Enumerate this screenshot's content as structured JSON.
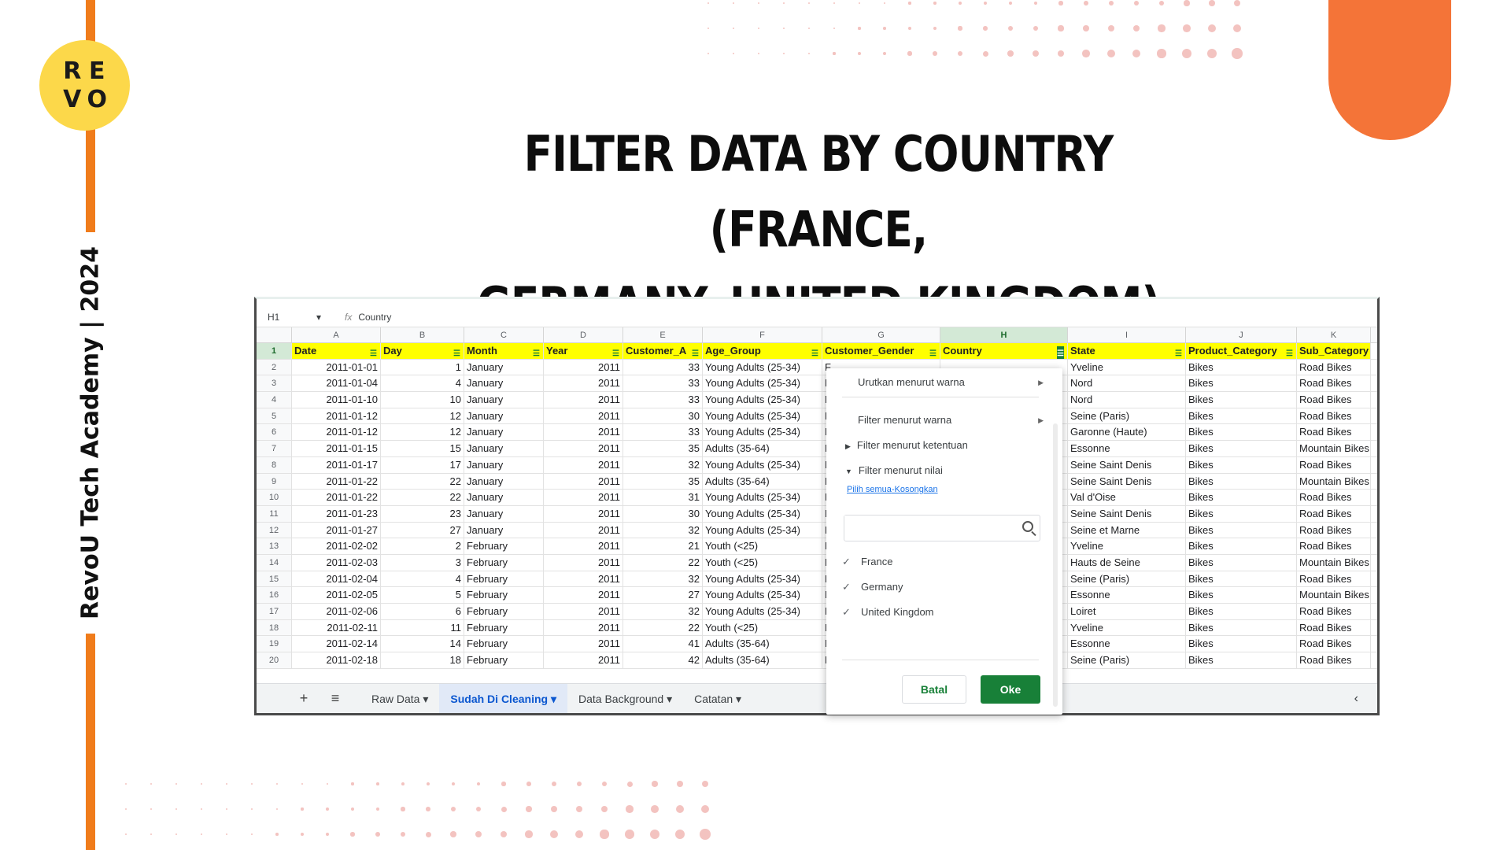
{
  "side_label": "RevoU Tech Academy | 2024",
  "logo_letters": [
    "R",
    "E",
    "V",
    "O"
  ],
  "headline": {
    "line1": "FILTER DATA BY COUNTRY (FRANCE,",
    "line2": "GERMANY, UNITED KINGDOM)"
  },
  "colors": {
    "accent_orange": "#f07c1b",
    "logo_yellow": "#fcd84a",
    "blob_orange": "#f47438",
    "header_yellow": "#ffff00",
    "sheets_green": "#188038"
  },
  "sheet": {
    "cell_ref": "H1",
    "formula_icon": "fx",
    "formula_value": "Country",
    "column_letters": [
      "A",
      "B",
      "C",
      "D",
      "E",
      "F",
      "G",
      "H",
      "I",
      "J",
      "K"
    ],
    "headers": [
      "Date",
      "Day",
      "Month",
      "Year",
      "Customer_A",
      "Age_Group",
      "Customer_Gender",
      "Country",
      "State",
      "Product_Category",
      "Sub_Category"
    ],
    "rows": [
      [
        "2",
        "2011-01-01",
        "1",
        "January",
        "2011",
        "33",
        "Young Adults (25-34)",
        "F",
        "",
        "Yveline",
        "Bikes",
        "Road Bikes"
      ],
      [
        "3",
        "2011-01-04",
        "4",
        "January",
        "2011",
        "33",
        "Young Adults (25-34)",
        "F",
        "",
        "Nord",
        "Bikes",
        "Road Bikes"
      ],
      [
        "4",
        "2011-01-10",
        "10",
        "January",
        "2011",
        "33",
        "Young Adults (25-34)",
        "F",
        "",
        "Nord",
        "Bikes",
        "Road Bikes"
      ],
      [
        "5",
        "2011-01-12",
        "12",
        "January",
        "2011",
        "30",
        "Young Adults (25-34)",
        "F",
        "",
        "Seine (Paris)",
        "Bikes",
        "Road Bikes"
      ],
      [
        "6",
        "2011-01-12",
        "12",
        "January",
        "2011",
        "33",
        "Young Adults (25-34)",
        "F",
        "",
        "Garonne (Haute)",
        "Bikes",
        "Road Bikes"
      ],
      [
        "7",
        "2011-01-15",
        "15",
        "January",
        "2011",
        "35",
        "Adults (35-64)",
        "F",
        "",
        "Essonne",
        "Bikes",
        "Mountain Bikes"
      ],
      [
        "8",
        "2011-01-17",
        "17",
        "January",
        "2011",
        "32",
        "Young Adults (25-34)",
        "F",
        "",
        "Seine Saint Denis",
        "Bikes",
        "Road Bikes"
      ],
      [
        "9",
        "2011-01-22",
        "22",
        "January",
        "2011",
        "35",
        "Adults (35-64)",
        "F",
        "",
        "Seine Saint Denis",
        "Bikes",
        "Mountain Bikes"
      ],
      [
        "10",
        "2011-01-22",
        "22",
        "January",
        "2011",
        "31",
        "Young Adults (25-34)",
        "F",
        "",
        "Val d'Oise",
        "Bikes",
        "Road Bikes"
      ],
      [
        "11",
        "2011-01-23",
        "23",
        "January",
        "2011",
        "30",
        "Young Adults (25-34)",
        "F",
        "",
        "Seine Saint Denis",
        "Bikes",
        "Road Bikes"
      ],
      [
        "12",
        "2011-01-27",
        "27",
        "January",
        "2011",
        "32",
        "Young Adults (25-34)",
        "F",
        "",
        "Seine et Marne",
        "Bikes",
        "Road Bikes"
      ],
      [
        "13",
        "2011-02-02",
        "2",
        "February",
        "2011",
        "21",
        "Youth (<25)",
        "M",
        "",
        "Yveline",
        "Bikes",
        "Road Bikes"
      ],
      [
        "14",
        "2011-02-03",
        "3",
        "February",
        "2011",
        "22",
        "Youth (<25)",
        "M",
        "",
        "Hauts de Seine",
        "Bikes",
        "Mountain Bikes"
      ],
      [
        "15",
        "2011-02-04",
        "4",
        "February",
        "2011",
        "32",
        "Young Adults (25-34)",
        "M",
        "",
        "Seine (Paris)",
        "Bikes",
        "Road Bikes"
      ],
      [
        "16",
        "2011-02-05",
        "5",
        "February",
        "2011",
        "27",
        "Young Adults (25-34)",
        "M",
        "",
        "Essonne",
        "Bikes",
        "Mountain Bikes"
      ],
      [
        "17",
        "2011-02-06",
        "6",
        "February",
        "2011",
        "32",
        "Young Adults (25-34)",
        "M",
        "",
        "Loiret",
        "Bikes",
        "Road Bikes"
      ],
      [
        "18",
        "2011-02-11",
        "11",
        "February",
        "2011",
        "22",
        "Youth (<25)",
        "M",
        "",
        "Yveline",
        "Bikes",
        "Road Bikes"
      ],
      [
        "19",
        "2011-02-14",
        "14",
        "February",
        "2011",
        "41",
        "Adults (35-64)",
        "F",
        "",
        "Essonne",
        "Bikes",
        "Road Bikes"
      ],
      [
        "20",
        "2011-02-18",
        "18",
        "February",
        "2011",
        "42",
        "Adults (35-64)",
        "F",
        "",
        "Seine (Paris)",
        "Bikes",
        "Road Bikes"
      ]
    ],
    "tabs": [
      "Raw Data",
      "Sudah Di Cleaning",
      "Data Background",
      "Catatan"
    ],
    "active_tab": "Sudah Di Cleaning"
  },
  "filter_popup": {
    "sort_by_color": "Urutkan menurut warna",
    "filter_by_color": "Filter menurut warna",
    "filter_by_condition": "Filter menurut ketentuan",
    "filter_by_value": "Filter menurut nilai",
    "select_all": "Pilih semua",
    "link_separator": "-",
    "clear": "Kosongkan",
    "search_value": "",
    "options": [
      {
        "label": "France",
        "checked": true
      },
      {
        "label": "Germany",
        "checked": true
      },
      {
        "label": "United Kingdom",
        "checked": true
      }
    ],
    "cancel_label": "Batal",
    "ok_label": "Oke"
  }
}
